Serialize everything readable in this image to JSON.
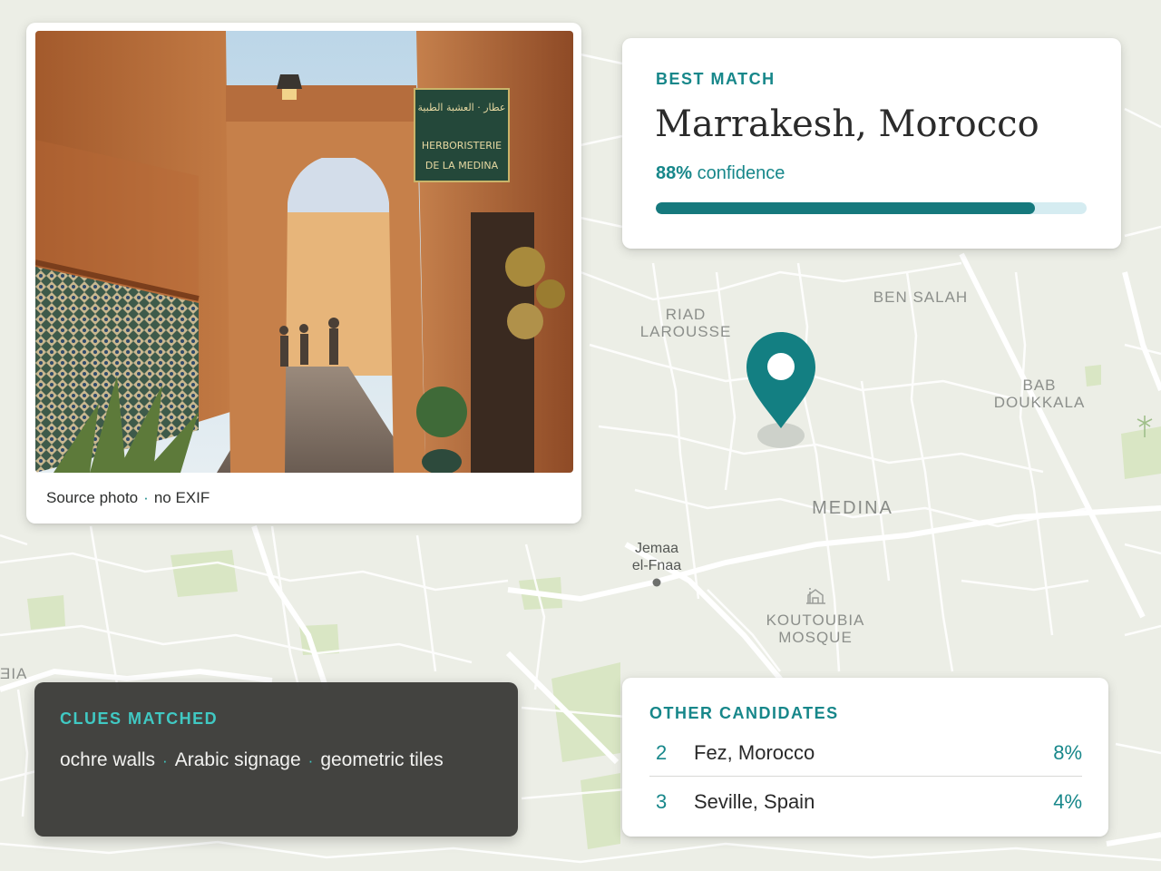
{
  "map": {
    "labels": {
      "riad_larousse": "RIAD\nLAROUSSE",
      "ben_salah": "BEN SALAH",
      "bab_doukkala": "BAB\nDOUKKALA",
      "medina": "MEDINA",
      "koutoubia": "KOUTOUBIA\nMOSQUE",
      "jemaa": "Jemaa\nel-Fnaa",
      "edge_fragment": "ƎIA"
    },
    "colors": {
      "background": "#eceee6",
      "road": "#ffffff",
      "park": "#d9e6c4",
      "pin": "#137f82"
    }
  },
  "photo_card": {
    "caption": "Source photo",
    "caption_separator": "·",
    "caption_note": "no EXIF",
    "sign": {
      "arabic": "عطار · العشبة الطبية",
      "line1": "HERBORISTERIE",
      "line2": "DE LA MEDINA"
    }
  },
  "best_match": {
    "eyebrow": "BEST MATCH",
    "place": "Marrakesh, Morocco",
    "confidence_value": "88%",
    "confidence_label": "confidence",
    "confidence_fraction": 0.88
  },
  "clues": {
    "title": "CLUES MATCHED",
    "items": [
      "ochre walls",
      "Arabic signage",
      "geometric tiles"
    ],
    "separator": "·"
  },
  "candidates": {
    "title": "OTHER CANDIDATES",
    "rows": [
      {
        "rank": "2",
        "place": "Fez, Morocco",
        "pct": "8%"
      },
      {
        "rank": "3",
        "place": "Seville, Spain",
        "pct": "4%"
      }
    ]
  }
}
